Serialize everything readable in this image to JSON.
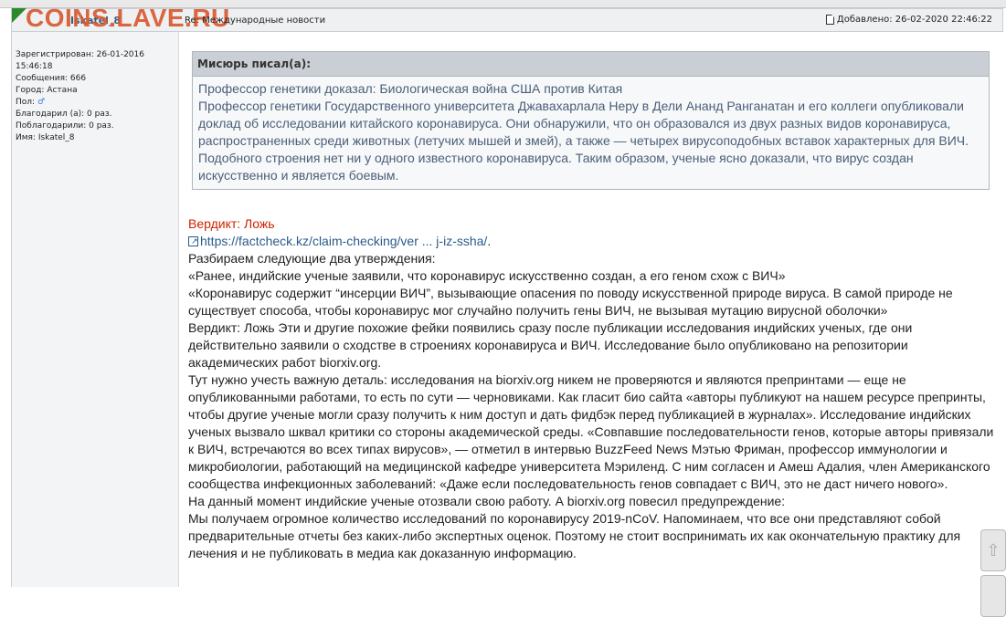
{
  "watermark": "COINS.LAVE.RU",
  "post": {
    "username": "Iskatel_8",
    "subject": "Re: Международные новости",
    "added": "Добавлено: 26-02-2020 22:46:22"
  },
  "user": {
    "registered": "Зарегистрирован: 26-01-2016",
    "registered_time": "15:46:18",
    "messages": "Сообщения: 666",
    "city": "Город: Астана",
    "gender_label": "Пол:",
    "gender_icon": "male-icon",
    "thanked": "Благодарил (а): 0 раз.",
    "thanked_by": "Поблагодарили: 0 раз.",
    "name": "Имя: Iskatel_8"
  },
  "quote": {
    "author": "Мисюрь писал(а):",
    "title": "Профессор генетики доказал: Биологическая война США против Китая",
    "body": "Профессор генетики Государственного университета Джавахарлала Неру в Дели Ананд Ранганатан и его коллеги опубликовали доклад об исследовании китайского коронавируса. Они обнаружили, что он образовался из двух разных видов коронавируса, распространенных среди животных (летучих мышей и змей), а также — четырех вирусоподобных вставок характерных для ВИЧ. Подобного строения нет ни у одного известного коронавируса. Таким образом, ученые ясно доказали, что вирус создан искусственно и является боевым."
  },
  "body": {
    "verdict": "Вердикт: Ложь",
    "link": "https://factcheck.kz/claim-checking/ver ... j-iz-ssha/",
    "link_suffix": ".",
    "p1": "Разбираем следующие два утверждения:",
    "p2": "«Ранее, индийские ученые заявили, что коронавирус искусственно создан, а его геном схож с ВИЧ»",
    "p3": "«Коронавирус содержит “инсерции ВИЧ”, вызывающие опасения по поводу искусственной природе вируса. В самой природе не существует способа, чтобы коронавирус мог случайно получить гены ВИЧ, не вызывая мутацию вирусной оболочки»",
    "p4": "Вердикт: Ложь Эти и другие похожие фейки появились сразу после публикации исследования индийских ученых, где они действительно заявили о сходстве в строениях коронавируса и ВИЧ. Исследование было опубликовано на репозитории академических работ biorxiv.org.",
    "p5": "Тут нужно учесть важную деталь: исследования на biorxiv.org никем не проверяются и являются препринтами — еще не опубликованными работами, то есть по сути — черновиками. Как гласит био сайта «авторы публикуют на нашем ресурсе препринты, чтобы другие ученые могли сразу получить к ним доступ и дать фидбэк перед публикацией в журналах». Исследование индийских ученых вызвало шквал критики со стороны академической среды. «Совпавшие последовательности генов, которые авторы привязали к ВИЧ, встречаются во всех типах вирусов», — отметил в интервью BuzzFeed News Мэтью Фриман, профессор иммунологии и микробиологии, работающий на медицинской кафедре университета Мэриленд. С ним согласен и Амеш Адалия, член Американского сообщества инфекционных заболеваний: «Даже если последовательность генов совпадает с ВИЧ, это не даст ничего нового».",
    "p6": "На данный момент индийские ученые отозвали свою работу. А biorxiv.org повесил предупреждение:",
    "p7": "Мы получаем огромное количество исследований по коронавирусу 2019-nCoV. Напоминаем, что все они представляют собой предварительные отчеты без каких-либо экспертных оценок. Поэтому не стоит воспринимать их как окончательную практику для лечения и не публиковать в медиа как доказанную информацию."
  },
  "scroll": {
    "up_icon": "arrow-up-icon"
  }
}
